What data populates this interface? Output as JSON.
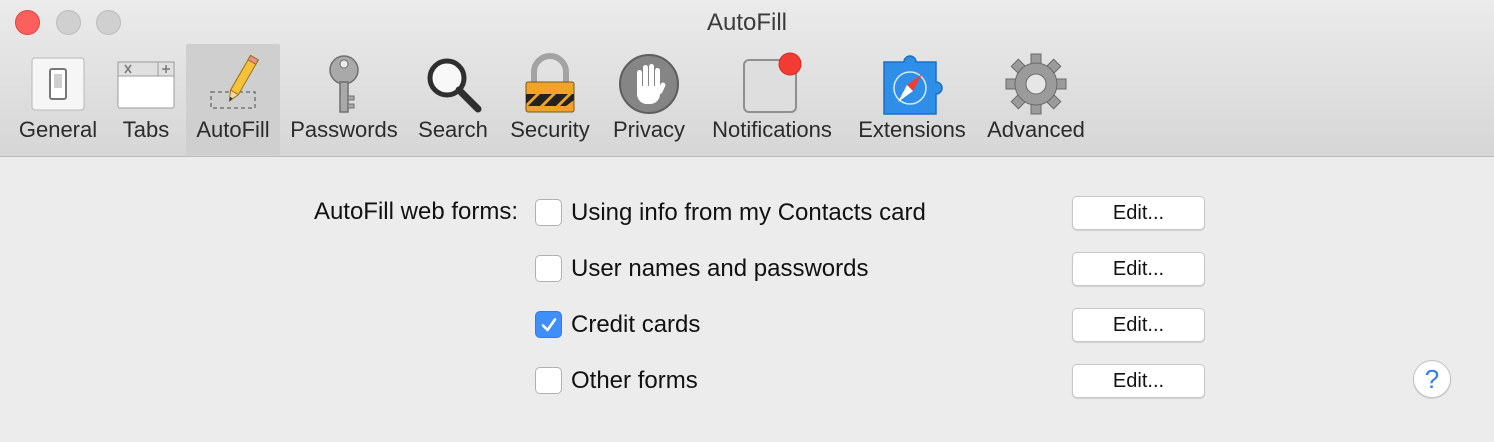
{
  "window": {
    "title": "AutoFill"
  },
  "toolbar": {
    "items": [
      {
        "label": "General",
        "icon": "general-switch-icon"
      },
      {
        "label": "Tabs",
        "icon": "tabs-icon"
      },
      {
        "label": "AutoFill",
        "icon": "pencil-icon",
        "selected": true
      },
      {
        "label": "Passwords",
        "icon": "key-icon"
      },
      {
        "label": "Search",
        "icon": "magnifier-icon"
      },
      {
        "label": "Security",
        "icon": "padlock-icon"
      },
      {
        "label": "Privacy",
        "icon": "hand-icon"
      },
      {
        "label": "Notifications",
        "icon": "notification-badge-icon"
      },
      {
        "label": "Extensions",
        "icon": "puzzle-compass-icon"
      },
      {
        "label": "Advanced",
        "icon": "gear-icon"
      }
    ]
  },
  "autofill": {
    "label": "AutoFill web forms:",
    "rows": [
      {
        "label": "Using info from my Contacts card",
        "checked": false,
        "button": "Edit..."
      },
      {
        "label": "User names and passwords",
        "checked": false,
        "button": "Edit..."
      },
      {
        "label": "Credit cards",
        "checked": true,
        "button": "Edit..."
      },
      {
        "label": "Other forms",
        "checked": false,
        "button": "Edit..."
      }
    ]
  },
  "help": {
    "symbol": "?"
  },
  "colors": {
    "accent": "#3f8ef9",
    "close": "#fc605c",
    "badge": "#f23b35"
  }
}
